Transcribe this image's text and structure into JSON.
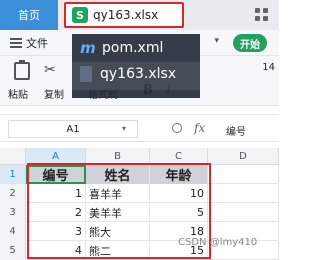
{
  "tabs": {
    "home": "首页",
    "file": "qy163.xlsx",
    "file_icon": "S"
  },
  "menu": {
    "file": "文件",
    "begin": "开始"
  },
  "toolbar": {
    "paste": "粘贴",
    "copy": "复制",
    "format_painter": "格式刷",
    "bold": "B",
    "italic": "I",
    "font_size": "14"
  },
  "switcher": [
    {
      "label": "pom.xml",
      "icon": "m"
    },
    {
      "label": "qy163.xlsx",
      "icon": "doc"
    }
  ],
  "formula_bar": {
    "cell_ref": "A1",
    "fx": "fx",
    "value": "编号"
  },
  "columns": [
    "A",
    "B",
    "C",
    "D"
  ],
  "rows": [
    {
      "n": "1",
      "a": "编号",
      "b": "姓名",
      "c": "年龄"
    },
    {
      "n": "2",
      "a": "1",
      "b": "喜羊羊",
      "c": "10"
    },
    {
      "n": "3",
      "a": "2",
      "b": "美羊羊",
      "c": "5"
    },
    {
      "n": "4",
      "a": "3",
      "b": "熊大",
      "c": "18"
    },
    {
      "n": "5",
      "a": "4",
      "b": "熊二",
      "c": "15"
    }
  ],
  "watermark": "CSDN @lmy410",
  "colors": {
    "accent": "#24a062",
    "highlight": "#e02424",
    "tab": "#3a8fd8"
  }
}
